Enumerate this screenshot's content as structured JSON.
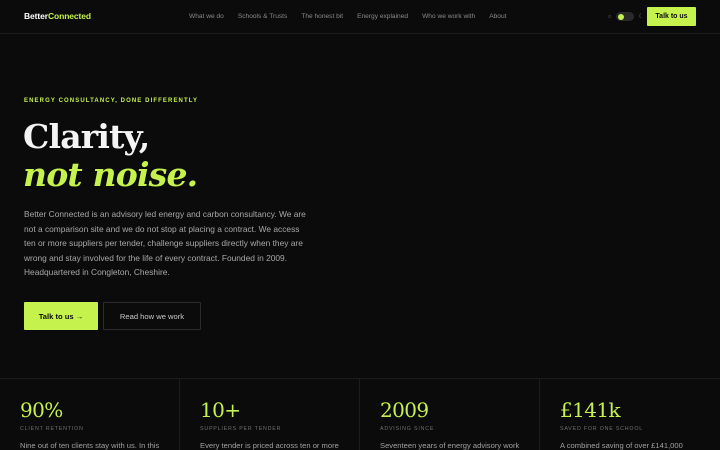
{
  "header": {
    "logo_part1": "Better",
    "logo_part2": "Connected",
    "nav": [
      {
        "label": "What we do"
      },
      {
        "label": "Schools & Trusts"
      },
      {
        "label": "The honest bit"
      },
      {
        "label": "Energy explained"
      },
      {
        "label": "Who we work with"
      },
      {
        "label": "About"
      }
    ],
    "theme_toggle": {
      "light_icon": "☼",
      "dark_icon": "☾",
      "state": "light"
    },
    "cta_label": "Talk to us"
  },
  "hero": {
    "eyebrow": "ENERGY CONSULTANCY, DONE DIFFERENTLY",
    "headline_line1": "Clarity,",
    "headline_line2": "not noise.",
    "intro": "Better Connected is an advisory led energy and carbon consultancy. We are not a comparison site and we do not stop at placing a contract. We access ten or more suppliers per tender, challenge suppliers directly when they are wrong and stay involved for the life of every contract. Founded in 2009. Headquartered in Congleton, Cheshire.",
    "primary_button": "Talk to us →",
    "secondary_button": "Read how we work"
  },
  "stats": [
    {
      "value": "90%",
      "label": "CLIENT RETENTION",
      "desc": "Nine out of ten clients stay with us. In this"
    },
    {
      "value": "10+",
      "label": "SUPPLIERS PER TENDER",
      "desc": "Every tender is priced across ten or more"
    },
    {
      "value": "2009",
      "label": "ADVISING SINCE",
      "desc": "Seventeen years of energy advisory work"
    },
    {
      "value": "£141k",
      "label": "SAVED FOR ONE SCHOOL",
      "desc": "A combined saving of over £141,000"
    }
  ],
  "colors": {
    "background": "#0b0b0b",
    "accent": "#c6f24e",
    "text": "#d6d6d6",
    "muted": "#8a8a8a"
  }
}
